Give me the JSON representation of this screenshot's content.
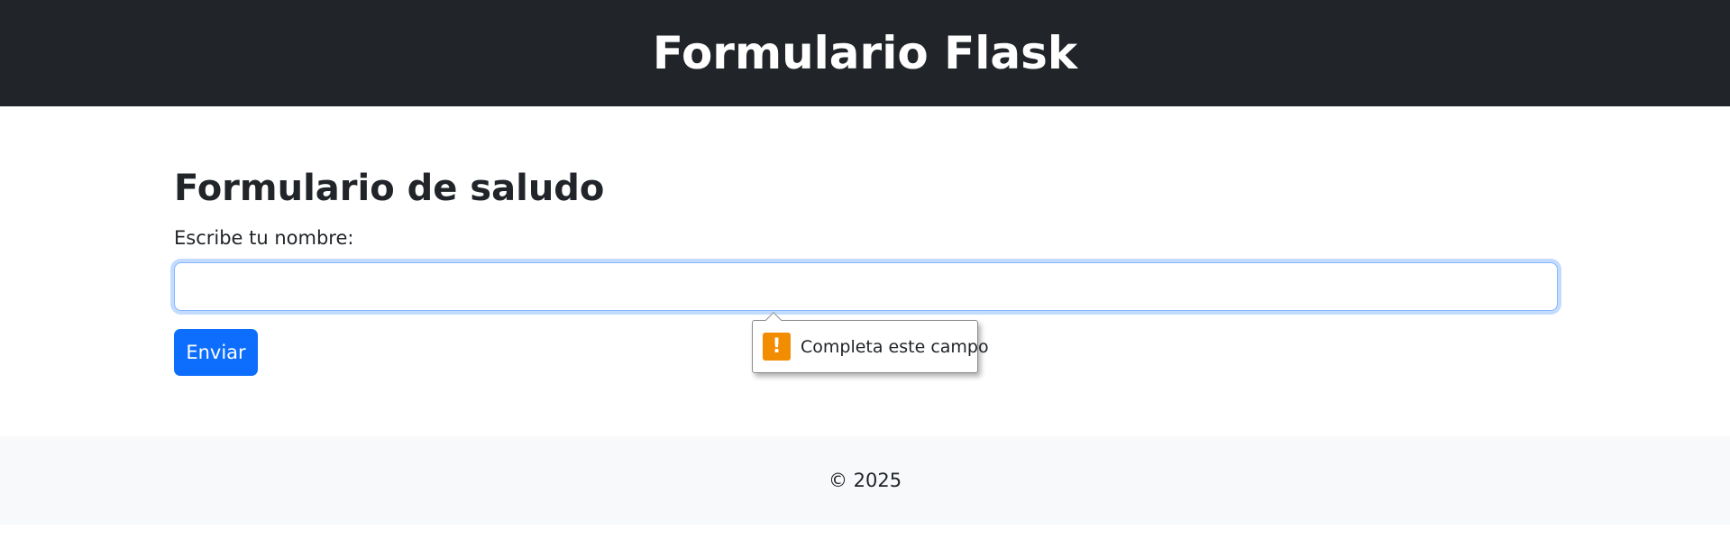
{
  "header": {
    "title": "Formulario Flask"
  },
  "form": {
    "title": "Formulario de saludo",
    "label": "Escribe tu nombre:",
    "input_value": "",
    "submit_label": "Enviar"
  },
  "validation_tooltip": {
    "icon": "warning-exclamation-icon",
    "icon_glyph": "!",
    "message": "Completa este campo",
    "icon_color": "#f28c00"
  },
  "footer": {
    "text": "© 2025"
  },
  "colors": {
    "header_bg": "#212529",
    "primary": "#0d6efd",
    "footer_bg": "#f8f9fa"
  }
}
